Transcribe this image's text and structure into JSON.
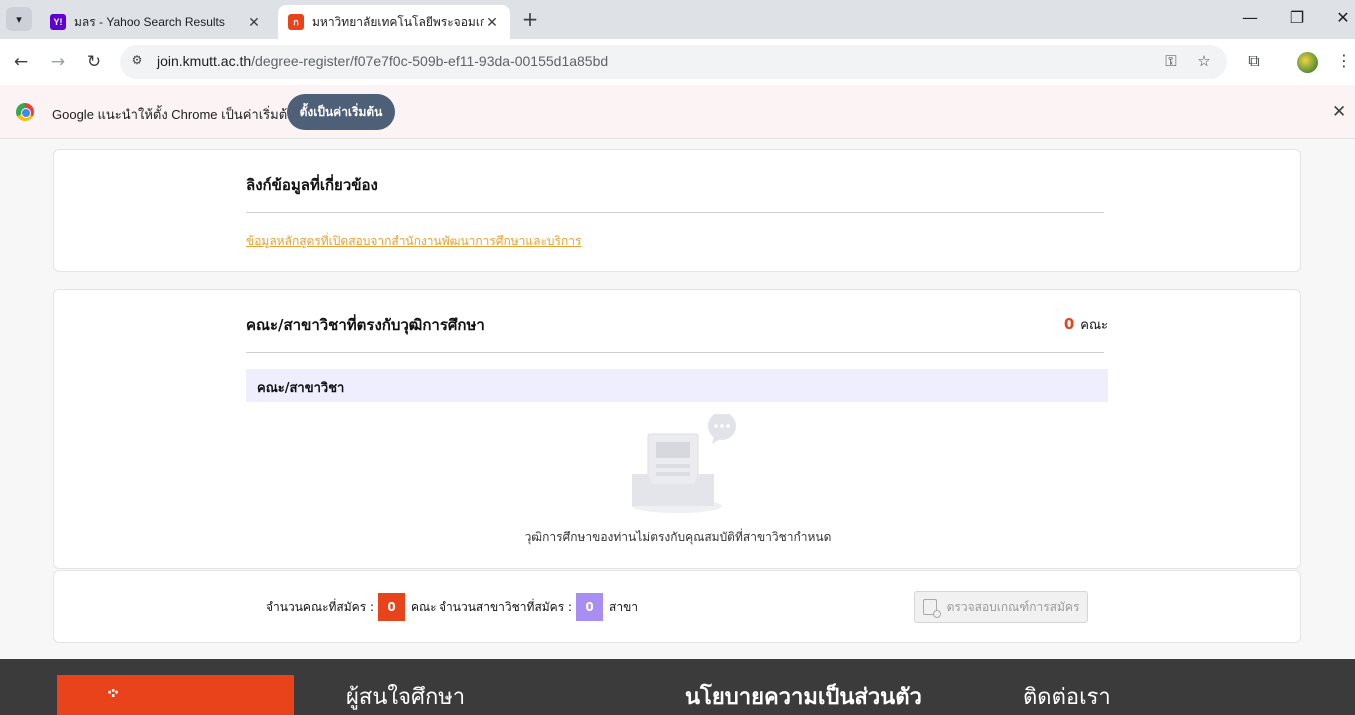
{
  "browser": {
    "tabs": [
      {
        "favicon": "Y!",
        "title": "มลร - Yahoo Search Results"
      },
      {
        "favicon": "ก",
        "title": "มหาวิทยาลัยเทคโนโลยีพระจอมเกล้าธ"
      }
    ],
    "url_host": "join.kmutt.ac.th",
    "url_path": "/degree-register/f07e7f0c-509b-ef11-93da-00155d1a85bd",
    "infobar": {
      "message": "Google แนะนำให้ตั้ง Chrome เป็นค่าเริ่มต้น",
      "button": "ตั้งเป็นค่าเริ่มต้น"
    }
  },
  "related": {
    "title": "ลิงก์ข้อมูลที่เกี่ยวข้อง",
    "link": "ข้อมูลหลักสูตรที่เปิดสอบจากสำนักงานพัฒนาการศึกษาและบริการ"
  },
  "faculties": {
    "title": "คณะ/สาขาวิชาที่ตรงกับวุฒิการศึกษา",
    "count": "0",
    "count_unit": "คณะ",
    "table_header": "คณะ/สาขาวิชา",
    "empty_message": "วุฒิการศึกษาของท่านไม่ตรงกับคุณสมบัติที่สาขาวิชากำหนด"
  },
  "summary": {
    "faculty_label": "จำนวนคณะที่สมัคร :",
    "faculty_count": "0",
    "faculty_unit": "คณะ",
    "major_label": "จำนวนสาขาวิชาที่สมัคร :",
    "major_count": "0",
    "major_unit": "สาขา",
    "check_button": "ตรวจสอบเกณฑ์การสมัคร"
  },
  "footer": {
    "col1": "ผู้สนใจศึกษา",
    "col2": "นโยบายความเป็นส่วนตัว",
    "col3": "ติดต่อเรา"
  },
  "colors": {
    "accent_orange": "#e8431a",
    "accent_purple": "#a88df2",
    "link": "#e8a033"
  }
}
